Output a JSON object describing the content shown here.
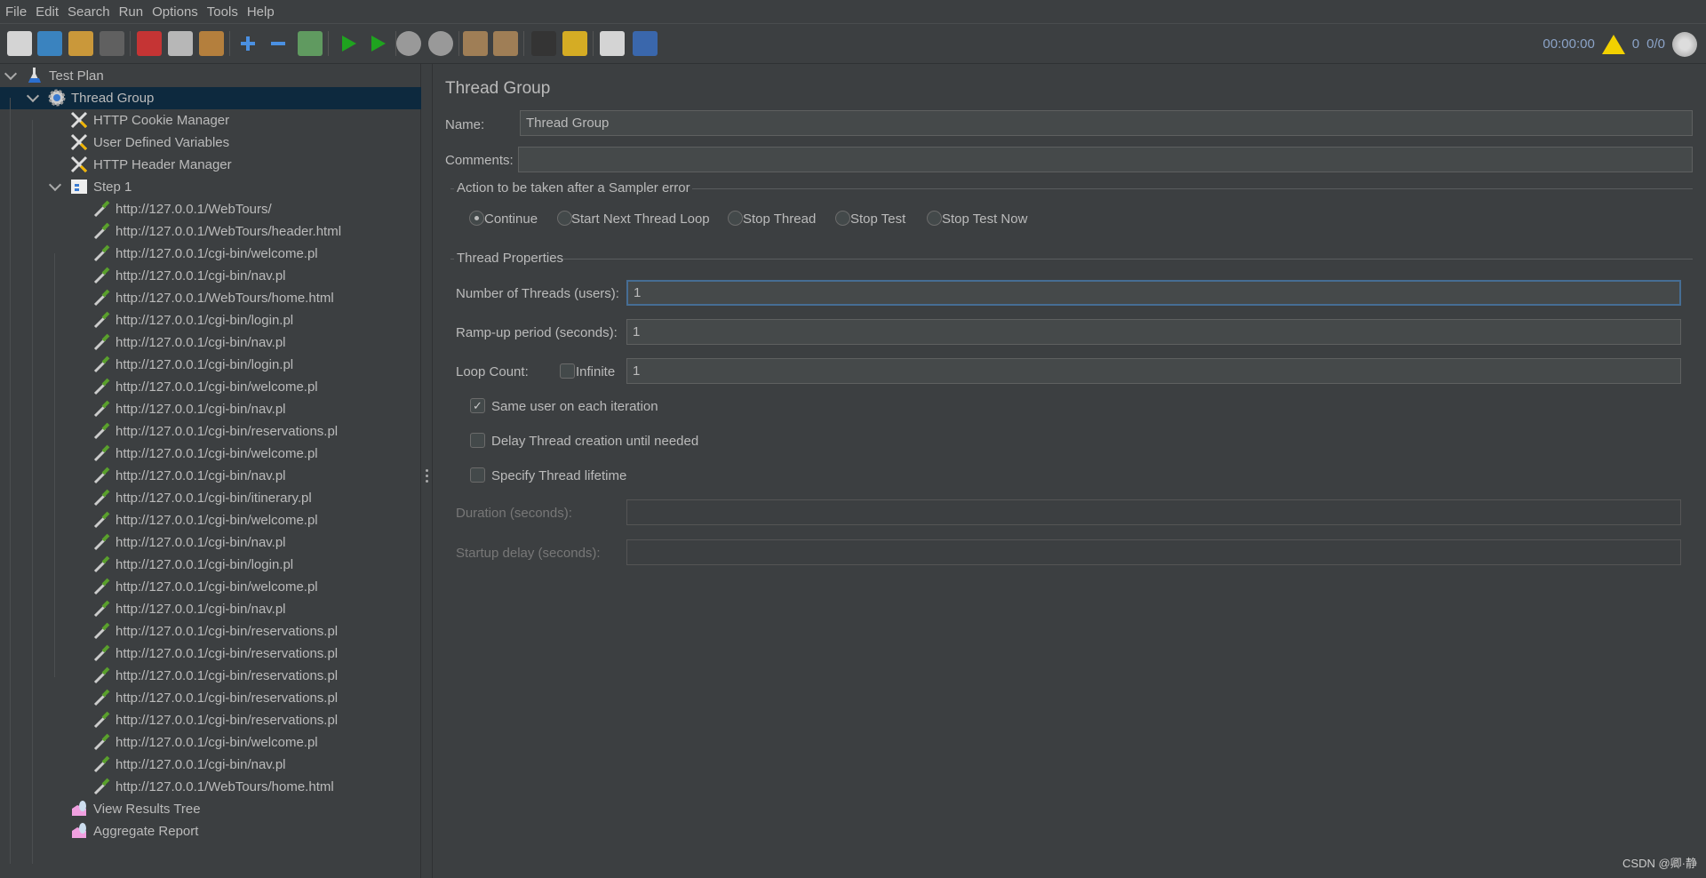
{
  "menu": [
    "File",
    "Edit",
    "Search",
    "Run",
    "Options",
    "Tools",
    "Help"
  ],
  "toolbar": {
    "buttons": [
      "new",
      "templates",
      "open",
      "save",
      "cut",
      "copy",
      "paste",
      "expand",
      "collapse",
      "toggle",
      "start",
      "start-no-pauses",
      "stop",
      "shutdown",
      "clear",
      "clear-all",
      "search",
      "reset-search",
      "function-helper",
      "help"
    ]
  },
  "status": {
    "elapsed": "00:00:00",
    "warnings": "0",
    "threads": "0/0"
  },
  "tree": [
    {
      "label": "Test Plan",
      "level": 0,
      "icon": "test-plan",
      "expanded": true
    },
    {
      "label": "Thread Group",
      "level": 1,
      "icon": "thread-group",
      "expanded": true,
      "selected": true
    },
    {
      "label": "HTTP Cookie Manager",
      "level": 2,
      "icon": "config"
    },
    {
      "label": "User Defined Variables",
      "level": 2,
      "icon": "config"
    },
    {
      "label": "HTTP Header Manager",
      "level": 2,
      "icon": "config"
    },
    {
      "label": "Step 1",
      "level": 2,
      "icon": "controller",
      "expanded": true
    },
    {
      "label": "http://127.0.0.1/WebTours/",
      "level": 3,
      "icon": "sampler"
    },
    {
      "label": "http://127.0.0.1/WebTours/header.html",
      "level": 3,
      "icon": "sampler"
    },
    {
      "label": "http://127.0.0.1/cgi-bin/welcome.pl",
      "level": 3,
      "icon": "sampler"
    },
    {
      "label": "http://127.0.0.1/cgi-bin/nav.pl",
      "level": 3,
      "icon": "sampler"
    },
    {
      "label": "http://127.0.0.1/WebTours/home.html",
      "level": 3,
      "icon": "sampler"
    },
    {
      "label": "http://127.0.0.1/cgi-bin/login.pl",
      "level": 3,
      "icon": "sampler"
    },
    {
      "label": "http://127.0.0.1/cgi-bin/nav.pl",
      "level": 3,
      "icon": "sampler"
    },
    {
      "label": "http://127.0.0.1/cgi-bin/login.pl",
      "level": 3,
      "icon": "sampler"
    },
    {
      "label": "http://127.0.0.1/cgi-bin/welcome.pl",
      "level": 3,
      "icon": "sampler"
    },
    {
      "label": "http://127.0.0.1/cgi-bin/nav.pl",
      "level": 3,
      "icon": "sampler"
    },
    {
      "label": "http://127.0.0.1/cgi-bin/reservations.pl",
      "level": 3,
      "icon": "sampler"
    },
    {
      "label": "http://127.0.0.1/cgi-bin/welcome.pl",
      "level": 3,
      "icon": "sampler"
    },
    {
      "label": "http://127.0.0.1/cgi-bin/nav.pl",
      "level": 3,
      "icon": "sampler"
    },
    {
      "label": "http://127.0.0.1/cgi-bin/itinerary.pl",
      "level": 3,
      "icon": "sampler"
    },
    {
      "label": "http://127.0.0.1/cgi-bin/welcome.pl",
      "level": 3,
      "icon": "sampler"
    },
    {
      "label": "http://127.0.0.1/cgi-bin/nav.pl",
      "level": 3,
      "icon": "sampler"
    },
    {
      "label": "http://127.0.0.1/cgi-bin/login.pl",
      "level": 3,
      "icon": "sampler"
    },
    {
      "label": "http://127.0.0.1/cgi-bin/welcome.pl",
      "level": 3,
      "icon": "sampler"
    },
    {
      "label": "http://127.0.0.1/cgi-bin/nav.pl",
      "level": 3,
      "icon": "sampler"
    },
    {
      "label": "http://127.0.0.1/cgi-bin/reservations.pl",
      "level": 3,
      "icon": "sampler"
    },
    {
      "label": "http://127.0.0.1/cgi-bin/reservations.pl",
      "level": 3,
      "icon": "sampler"
    },
    {
      "label": "http://127.0.0.1/cgi-bin/reservations.pl",
      "level": 3,
      "icon": "sampler"
    },
    {
      "label": "http://127.0.0.1/cgi-bin/reservations.pl",
      "level": 3,
      "icon": "sampler"
    },
    {
      "label": "http://127.0.0.1/cgi-bin/reservations.pl",
      "level": 3,
      "icon": "sampler"
    },
    {
      "label": "http://127.0.0.1/cgi-bin/welcome.pl",
      "level": 3,
      "icon": "sampler"
    },
    {
      "label": "http://127.0.0.1/cgi-bin/nav.pl",
      "level": 3,
      "icon": "sampler"
    },
    {
      "label": "http://127.0.0.1/WebTours/home.html",
      "level": 3,
      "icon": "sampler"
    },
    {
      "label": "View Results Tree",
      "level": 2,
      "icon": "listener"
    },
    {
      "label": "Aggregate Report",
      "level": 2,
      "icon": "listener"
    }
  ],
  "panel": {
    "title": "Thread Group",
    "name_label": "Name:",
    "name_value": "Thread Group",
    "comments_label": "Comments:",
    "comments_value": "",
    "error_section": "Action to be taken after a Sampler error",
    "error_actions": [
      {
        "label": "Continue",
        "selected": true
      },
      {
        "label": "Start Next Thread Loop",
        "selected": false
      },
      {
        "label": "Stop Thread",
        "selected": false
      },
      {
        "label": "Stop Test",
        "selected": false
      },
      {
        "label": "Stop Test Now",
        "selected": false
      }
    ],
    "props_section": "Thread Properties",
    "threads_label": "Number of Threads (users):",
    "threads_value": "1",
    "rampup_label": "Ramp-up period (seconds):",
    "rampup_value": "1",
    "loop_label": "Loop Count:",
    "infinite_label": "Infinite",
    "infinite_checked": false,
    "loop_value": "1",
    "same_user_label": "Same user on each iteration",
    "same_user_checked": true,
    "delay_label": "Delay Thread creation until needed",
    "delay_checked": false,
    "lifetime_label": "Specify Thread lifetime",
    "lifetime_checked": false,
    "duration_label": "Duration (seconds):",
    "duration_value": "",
    "startup_label": "Startup delay (seconds):",
    "startup_value": ""
  },
  "watermark": "CSDN @卿·静",
  "colors": {
    "background": "#3c3f41",
    "selection": "#0d293e",
    "field": "#45494a",
    "focus": "#466d94",
    "text": "#bbbbbb"
  }
}
